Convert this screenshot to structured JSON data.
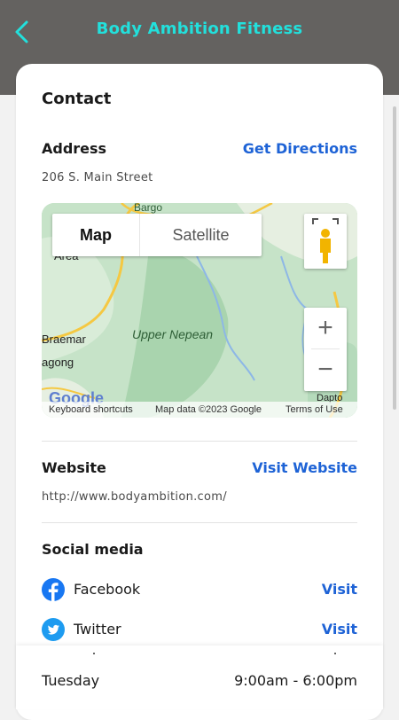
{
  "header": {
    "title": "Body Ambition Fitness",
    "back_icon": "chevron-left-icon"
  },
  "colors": {
    "accent": "#22e0dc",
    "link": "#1e63d6",
    "header_bg": "#646260"
  },
  "contact": {
    "heading": "Contact",
    "address_label": "Address",
    "directions_link": "Get Directions",
    "address_value": "206 S. Main Street"
  },
  "map": {
    "type_map": "Map",
    "type_satellite": "Satellite",
    "labels": {
      "bargo": "Bargo",
      "upper_nepean": "Upper Nepean",
      "braemar": "Braemar",
      "agong": "agong",
      "area": "Area",
      "dapto": "Dapto",
      "google": "Google"
    },
    "attribution": {
      "shortcuts": "Keyboard shortcuts",
      "data": "Map data ©2023 Google",
      "terms": "Terms of Use"
    },
    "zoom_in": "+",
    "zoom_out": "−"
  },
  "website": {
    "label": "Website",
    "link": "Visit Website",
    "url": "http://www.bodyambition.com/"
  },
  "social": {
    "heading": "Social media",
    "items": [
      {
        "name": "Facebook",
        "action": "Visit",
        "icon": "facebook-icon"
      },
      {
        "name": "Twitter",
        "action": "Visit",
        "icon": "twitter-icon"
      }
    ]
  },
  "hours": [
    {
      "day": "Tuesday",
      "time": "9:00am - 6:00pm"
    }
  ]
}
